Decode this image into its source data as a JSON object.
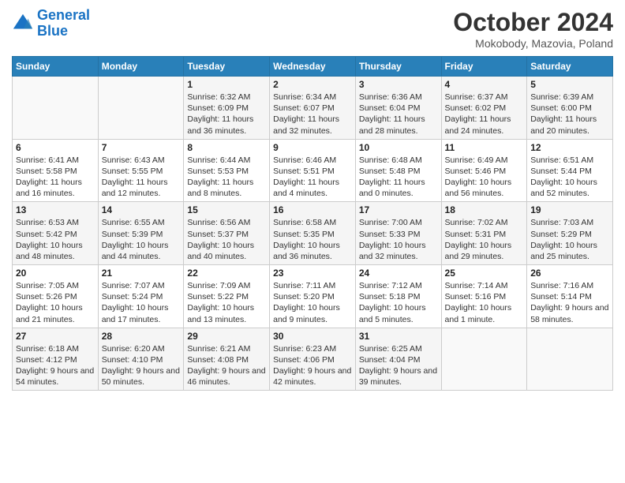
{
  "header": {
    "logo_line1": "General",
    "logo_line2": "Blue",
    "title": "October 2024",
    "subtitle": "Mokobody, Mazovia, Poland"
  },
  "weekdays": [
    "Sunday",
    "Monday",
    "Tuesday",
    "Wednesday",
    "Thursday",
    "Friday",
    "Saturday"
  ],
  "weeks": [
    [
      {
        "day": "",
        "info": ""
      },
      {
        "day": "",
        "info": ""
      },
      {
        "day": "1",
        "info": "Sunrise: 6:32 AM\nSunset: 6:09 PM\nDaylight: 11 hours and 36 minutes."
      },
      {
        "day": "2",
        "info": "Sunrise: 6:34 AM\nSunset: 6:07 PM\nDaylight: 11 hours and 32 minutes."
      },
      {
        "day": "3",
        "info": "Sunrise: 6:36 AM\nSunset: 6:04 PM\nDaylight: 11 hours and 28 minutes."
      },
      {
        "day": "4",
        "info": "Sunrise: 6:37 AM\nSunset: 6:02 PM\nDaylight: 11 hours and 24 minutes."
      },
      {
        "day": "5",
        "info": "Sunrise: 6:39 AM\nSunset: 6:00 PM\nDaylight: 11 hours and 20 minutes."
      }
    ],
    [
      {
        "day": "6",
        "info": "Sunrise: 6:41 AM\nSunset: 5:58 PM\nDaylight: 11 hours and 16 minutes."
      },
      {
        "day": "7",
        "info": "Sunrise: 6:43 AM\nSunset: 5:55 PM\nDaylight: 11 hours and 12 minutes."
      },
      {
        "day": "8",
        "info": "Sunrise: 6:44 AM\nSunset: 5:53 PM\nDaylight: 11 hours and 8 minutes."
      },
      {
        "day": "9",
        "info": "Sunrise: 6:46 AM\nSunset: 5:51 PM\nDaylight: 11 hours and 4 minutes."
      },
      {
        "day": "10",
        "info": "Sunrise: 6:48 AM\nSunset: 5:48 PM\nDaylight: 11 hours and 0 minutes."
      },
      {
        "day": "11",
        "info": "Sunrise: 6:49 AM\nSunset: 5:46 PM\nDaylight: 10 hours and 56 minutes."
      },
      {
        "day": "12",
        "info": "Sunrise: 6:51 AM\nSunset: 5:44 PM\nDaylight: 10 hours and 52 minutes."
      }
    ],
    [
      {
        "day": "13",
        "info": "Sunrise: 6:53 AM\nSunset: 5:42 PM\nDaylight: 10 hours and 48 minutes."
      },
      {
        "day": "14",
        "info": "Sunrise: 6:55 AM\nSunset: 5:39 PM\nDaylight: 10 hours and 44 minutes."
      },
      {
        "day": "15",
        "info": "Sunrise: 6:56 AM\nSunset: 5:37 PM\nDaylight: 10 hours and 40 minutes."
      },
      {
        "day": "16",
        "info": "Sunrise: 6:58 AM\nSunset: 5:35 PM\nDaylight: 10 hours and 36 minutes."
      },
      {
        "day": "17",
        "info": "Sunrise: 7:00 AM\nSunset: 5:33 PM\nDaylight: 10 hours and 32 minutes."
      },
      {
        "day": "18",
        "info": "Sunrise: 7:02 AM\nSunset: 5:31 PM\nDaylight: 10 hours and 29 minutes."
      },
      {
        "day": "19",
        "info": "Sunrise: 7:03 AM\nSunset: 5:29 PM\nDaylight: 10 hours and 25 minutes."
      }
    ],
    [
      {
        "day": "20",
        "info": "Sunrise: 7:05 AM\nSunset: 5:26 PM\nDaylight: 10 hours and 21 minutes."
      },
      {
        "day": "21",
        "info": "Sunrise: 7:07 AM\nSunset: 5:24 PM\nDaylight: 10 hours and 17 minutes."
      },
      {
        "day": "22",
        "info": "Sunrise: 7:09 AM\nSunset: 5:22 PM\nDaylight: 10 hours and 13 minutes."
      },
      {
        "day": "23",
        "info": "Sunrise: 7:11 AM\nSunset: 5:20 PM\nDaylight: 10 hours and 9 minutes."
      },
      {
        "day": "24",
        "info": "Sunrise: 7:12 AM\nSunset: 5:18 PM\nDaylight: 10 hours and 5 minutes."
      },
      {
        "day": "25",
        "info": "Sunrise: 7:14 AM\nSunset: 5:16 PM\nDaylight: 10 hours and 1 minute."
      },
      {
        "day": "26",
        "info": "Sunrise: 7:16 AM\nSunset: 5:14 PM\nDaylight: 9 hours and 58 minutes."
      }
    ],
    [
      {
        "day": "27",
        "info": "Sunrise: 6:18 AM\nSunset: 4:12 PM\nDaylight: 9 hours and 54 minutes."
      },
      {
        "day": "28",
        "info": "Sunrise: 6:20 AM\nSunset: 4:10 PM\nDaylight: 9 hours and 50 minutes."
      },
      {
        "day": "29",
        "info": "Sunrise: 6:21 AM\nSunset: 4:08 PM\nDaylight: 9 hours and 46 minutes."
      },
      {
        "day": "30",
        "info": "Sunrise: 6:23 AM\nSunset: 4:06 PM\nDaylight: 9 hours and 42 minutes."
      },
      {
        "day": "31",
        "info": "Sunrise: 6:25 AM\nSunset: 4:04 PM\nDaylight: 9 hours and 39 minutes."
      },
      {
        "day": "",
        "info": ""
      },
      {
        "day": "",
        "info": ""
      }
    ]
  ]
}
